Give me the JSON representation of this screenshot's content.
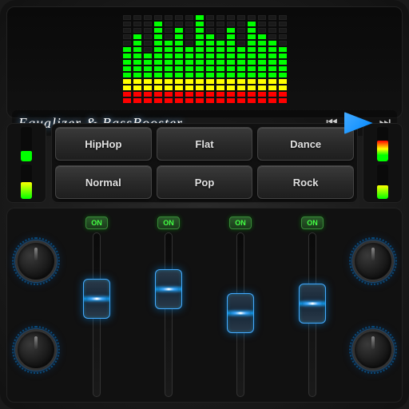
{
  "app": {
    "title": "Equalizer & BassBooster",
    "background_color": "#1a1a1a"
  },
  "transport": {
    "prev_label": "⏮",
    "next_label": "⏭",
    "play_label": "▶"
  },
  "presets": {
    "buttons": [
      {
        "id": "hiphop",
        "label": "HipHop"
      },
      {
        "id": "flat",
        "label": "Flat"
      },
      {
        "id": "dance",
        "label": "Dance"
      },
      {
        "id": "normal",
        "label": "Normal"
      },
      {
        "id": "pop",
        "label": "Pop"
      },
      {
        "id": "rock",
        "label": "Rock"
      }
    ]
  },
  "eq": {
    "channels": [
      {
        "id": "ch1",
        "on_label": "ON"
      },
      {
        "id": "ch2",
        "on_label": "ON"
      },
      {
        "id": "ch3",
        "on_label": "ON"
      },
      {
        "id": "ch4",
        "on_label": "ON"
      }
    ],
    "knob_left_top": "bass",
    "knob_left_bottom": "treble",
    "knob_right_top": "volume",
    "knob_right_bottom": "balance"
  },
  "spectrum": {
    "columns": 16,
    "heights": [
      8,
      10,
      7,
      12,
      9,
      11,
      8,
      13,
      10,
      9,
      11,
      8,
      12,
      10,
      9,
      8
    ]
  },
  "colors": {
    "accent_blue": "#00aaff",
    "accent_green": "#00ff00",
    "accent_yellow": "#ffff00",
    "accent_red": "#ff0000",
    "bg_dark": "#111111",
    "bg_panel": "#1a1a1a"
  }
}
